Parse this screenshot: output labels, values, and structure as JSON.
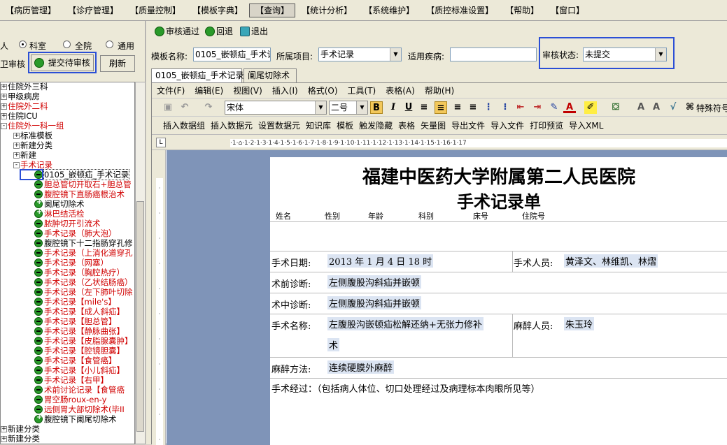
{
  "menubar": {
    "items": [
      "【病历管理】",
      "【诊疗管理】",
      "【质量控制】",
      "【模板字典】",
      "【查询】",
      "【统计分析】",
      "【系统维护】",
      "【质控标准设置】",
      "【帮助】",
      "【窗口】"
    ],
    "active_index": 4
  },
  "left": {
    "radio_partial_label": "人",
    "radios": [
      {
        "label": "科室",
        "checked": true
      },
      {
        "label": "全院",
        "checked": false
      },
      {
        "label": "通用",
        "checked": false
      }
    ],
    "partial_button": "卫审核",
    "submit_button": "提交待审核",
    "refresh_button": "刷新",
    "tree": [
      {
        "text": "住院外三科",
        "red": false,
        "level": 0,
        "exp": "+"
      },
      {
        "text": "甲级病房",
        "red": false,
        "level": 0,
        "exp": "+"
      },
      {
        "text": "住院外二科",
        "red": true,
        "level": 0,
        "exp": "+"
      },
      {
        "text": "住院ICU",
        "red": false,
        "level": 0,
        "exp": "+"
      },
      {
        "text": "住院外一科一组",
        "red": true,
        "level": 0,
        "exp": "-"
      },
      {
        "text": "标准模板",
        "red": false,
        "level": 1,
        "exp": "+"
      },
      {
        "text": "新建分类",
        "red": false,
        "level": 1,
        "exp": "+"
      },
      {
        "text": "新建",
        "red": false,
        "level": 1,
        "exp": "+"
      },
      {
        "text": "手术记录",
        "red": true,
        "level": 1,
        "exp": "-"
      },
      {
        "text": "0105_嵌顿疝_手术记录",
        "red": false,
        "level": 2,
        "icon": "m",
        "selected": true
      },
      {
        "text": "胆总管切开取石+胆总管",
        "red": true,
        "level": 2,
        "icon": "m"
      },
      {
        "text": "腹腔镜下直肠癌根治术",
        "red": true,
        "level": 2,
        "icon": "m"
      },
      {
        "text": "阑尾切除术",
        "red": false,
        "level": 2,
        "icon": "g"
      },
      {
        "text": "淋巴结活检",
        "red": true,
        "level": 2,
        "icon": "g"
      },
      {
        "text": "脓肿切开引流术",
        "red": true,
        "level": 2,
        "icon": "m"
      },
      {
        "text": "手术记录（肺大泡）",
        "red": true,
        "level": 2,
        "icon": "m"
      },
      {
        "text": "腹腔镜下十二指肠穿孔修",
        "red": false,
        "level": 2,
        "icon": "m"
      },
      {
        "text": "手术记录（上消化道穿孔",
        "red": true,
        "level": 2,
        "icon": "m"
      },
      {
        "text": "手术记录（网塞）",
        "red": true,
        "level": 2,
        "icon": "m"
      },
      {
        "text": "手术记录（胸腔热疗）",
        "red": true,
        "level": 2,
        "icon": "m"
      },
      {
        "text": "手术记录（乙状结肠癌）",
        "red": true,
        "level": 2,
        "icon": "m"
      },
      {
        "text": "手术记录（左下肺叶切除",
        "red": true,
        "level": 2,
        "icon": "m"
      },
      {
        "text": "手术记录【mile's】",
        "red": true,
        "level": 2,
        "icon": "m"
      },
      {
        "text": "手术记录【成人斜疝】",
        "red": true,
        "level": 2,
        "icon": "m"
      },
      {
        "text": "手术记录【胆总管】",
        "red": true,
        "level": 2,
        "icon": "m"
      },
      {
        "text": "手术记录【静脉曲张】",
        "red": true,
        "level": 2,
        "icon": "m"
      },
      {
        "text": "手术记录【皮脂腺囊肿】",
        "red": true,
        "level": 2,
        "icon": "m"
      },
      {
        "text": "手术记录【腔镜胆囊】",
        "red": true,
        "level": 2,
        "icon": "m"
      },
      {
        "text": "手术记录【食管癌】",
        "red": true,
        "level": 2,
        "icon": "m"
      },
      {
        "text": "手术记录【小儿斜疝】",
        "red": true,
        "level": 2,
        "icon": "m"
      },
      {
        "text": "手术记录【右甲】",
        "red": true,
        "level": 2,
        "icon": "m"
      },
      {
        "text": "术前讨论记录【食管癌",
        "red": true,
        "level": 2,
        "icon": "m"
      },
      {
        "text": "胃空肠roux-en-y",
        "red": true,
        "level": 2,
        "icon": "m"
      },
      {
        "text": "远侧胃大部切除术(毕II",
        "red": true,
        "level": 2,
        "icon": "m"
      },
      {
        "text": "腹腔镜下阑尾切除术",
        "red": false,
        "level": 2,
        "icon": "g"
      },
      {
        "text": "新建分类",
        "red": false,
        "level": 0,
        "exp": "+"
      },
      {
        "text": "新建分类",
        "red": false,
        "level": 0,
        "exp": "+"
      }
    ]
  },
  "toolbar": {
    "approve": "审核通过",
    "reject": "回退",
    "exit": "退出"
  },
  "form": {
    "template_name_label": "模板名称:",
    "template_name_value": "0105_嵌顿疝_手术记",
    "project_label": "所属项目:",
    "project_value": "手术记录",
    "disease_label": "适用疾病:",
    "disease_value": "",
    "status_label": "审核状态:",
    "status_value": "未提交"
  },
  "tabs": [
    "0105_嵌顿疝_手术记录",
    "阑尾切除术"
  ],
  "editor_menu": [
    "文件(F)",
    "编辑(E)",
    "视图(V)",
    "插入(I)",
    "格式(O)",
    "工具(T)",
    "表格(A)",
    "帮助(H)"
  ],
  "font": {
    "family": "宋体",
    "size": "二号"
  },
  "editor_toolbar_extra": "特殊符号",
  "editor_toolbar2": [
    "插入数据组",
    "插入数据元",
    "设置数据元",
    "知识库",
    "模板",
    "触发隐藏",
    "表格",
    "矢量图",
    "导出文件",
    "导入文件",
    "打印预览",
    "导入XML"
  ],
  "ruler_text": "·1·⌂·1·2·1·3·1·4·1·5·1·6·1·7·1·8·1·9·1·10·1·11·1·12·1·13·1·14·1·15·1·16·1·17",
  "document": {
    "hospital": "福建中医药大学附属第二人民医院",
    "title": "手术记录单",
    "headers": [
      "姓名",
      "性别",
      "年龄",
      "科别",
      "床号",
      "住院号"
    ],
    "rows": [
      {
        "label": "手术日期:",
        "value": "2013 年 1 月 4 日 18 时",
        "label2": "手术人员:",
        "value2": "黄泽文、林维凯、林熠"
      },
      {
        "label": "术前诊断:",
        "value": "左侧腹股沟斜疝并嵌顿"
      },
      {
        "label": "术中诊断:",
        "value": "左侧腹股沟斜疝并嵌顿"
      },
      {
        "label": "手术名称:",
        "value": "左腹股沟嵌顿疝松解还纳+无张力修补",
        "value_cont": "术",
        "label2": "麻醉人员:",
        "value2": "朱玉玲"
      },
      {
        "label": "麻醉方法:",
        "value": "连续硬膜外麻醉"
      }
    ],
    "cut_line": "手术经过：（包括病人体位、切口处理经过及病理标本肉眼所见等）"
  }
}
